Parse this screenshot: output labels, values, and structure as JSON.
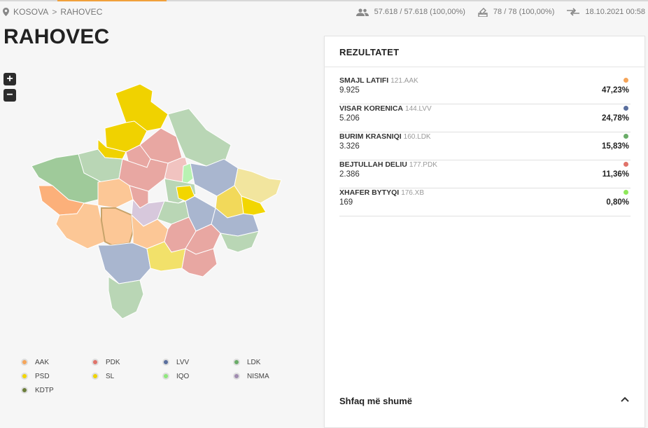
{
  "breadcrumb": {
    "items": [
      "KOSOVA",
      "RAHOVEC"
    ],
    "separator": ">"
  },
  "stats": {
    "voters": "57.618 / 57.618 (100,00%)",
    "stations": "78 / 78 (100,00%)",
    "updated": "18.10.2021 00:58"
  },
  "title": "RAHOVEC",
  "zoom": {
    "in_label": "+",
    "out_label": "−"
  },
  "legend": [
    {
      "label": "AAK",
      "color": "#f5a55a"
    },
    {
      "label": "PDK",
      "color": "#e0736a"
    },
    {
      "label": "LVV",
      "color": "#5a6f9e"
    },
    {
      "label": "LDK",
      "color": "#6aac68"
    },
    {
      "label": "PSD",
      "color": "#f2d600"
    },
    {
      "label": "SL",
      "color": "#eed400"
    },
    {
      "label": "IQO",
      "color": "#8ee87c"
    },
    {
      "label": "NISMA",
      "color": "#a08cb0"
    },
    {
      "label": "KDTP",
      "color": "#6b7d3a"
    }
  ],
  "results": {
    "header": "REZULTATET",
    "rows": [
      {
        "name": "SMAJL LATIFI",
        "number": "121.AAK",
        "votes": "9.925",
        "percent": "47,23%",
        "color": "#f5a55a"
      },
      {
        "name": "VISAR KORENICA",
        "number": "144.LVV",
        "votes": "5.206",
        "percent": "24,78%",
        "color": "#5a6f9e"
      },
      {
        "name": "BURIM KRASNIQI",
        "number": "160.LDK",
        "votes": "3.326",
        "percent": "15,83%",
        "color": "#6aac68"
      },
      {
        "name": "BEJTULLAH DELIU",
        "number": "177.PDK",
        "votes": "2.386",
        "percent": "11,36%",
        "color": "#e0736a"
      },
      {
        "name": "XHAFER BYTYQI",
        "number": "176.XB",
        "votes": "169",
        "percent": "0,80%",
        "color": "#8ee85a"
      }
    ],
    "show_more": "Shfaq më shumë"
  }
}
